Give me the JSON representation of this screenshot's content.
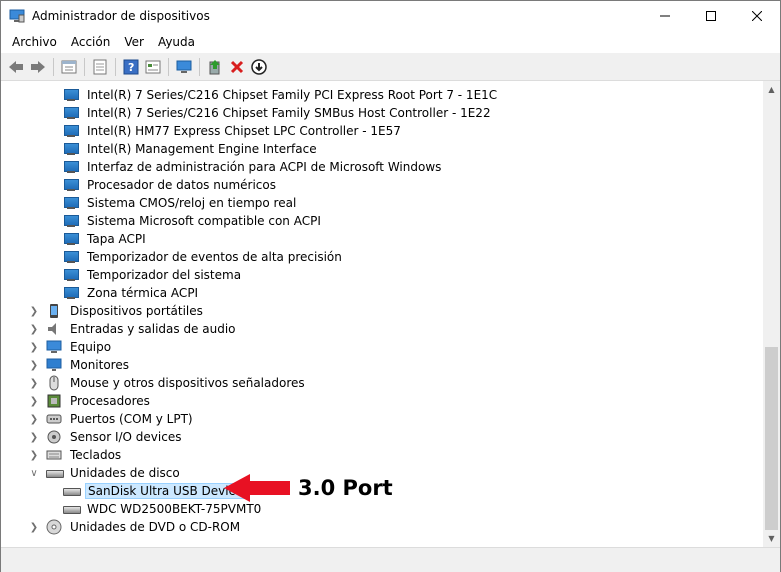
{
  "window": {
    "title": "Administrador de dispositivos"
  },
  "menu": [
    "Archivo",
    "Acción",
    "Ver",
    "Ayuda"
  ],
  "toolbar": [
    "back-icon",
    "forward-icon",
    "properties-icon",
    "show-hidden-icon",
    "help-icon",
    "view-icon",
    "monitor-icon",
    "update-driver-icon",
    "uninstall-icon",
    "disable-icon"
  ],
  "tree": {
    "system_children": [
      "Intel(R) 7 Series/C216 Chipset Family PCI Express Root Port 7 - 1E1C",
      "Intel(R) 7 Series/C216 Chipset Family SMBus Host Controller - 1E22",
      "Intel(R) HM77 Express Chipset LPC Controller - 1E57",
      "Intel(R) Management Engine Interface",
      "Interfaz de administración para ACPI de Microsoft Windows",
      "Procesador de datos numéricos",
      "Sistema CMOS/reloj en tiempo real",
      "Sistema Microsoft compatible con ACPI",
      "Tapa ACPI",
      "Temporizador de eventos de alta precisión",
      "Temporizador del sistema",
      "Zona térmica ACPI"
    ],
    "categories_before": [
      {
        "label": "Dispositivos portátiles",
        "icon": "portable-device-icon"
      },
      {
        "label": "Entradas y salidas de audio",
        "icon": "audio-icon"
      },
      {
        "label": "Equipo",
        "icon": "computer-icon"
      },
      {
        "label": "Monitores",
        "icon": "monitor-icon"
      },
      {
        "label": "Mouse y otros dispositivos señaladores",
        "icon": "mouse-icon"
      },
      {
        "label": "Procesadores",
        "icon": "processor-icon"
      },
      {
        "label": "Puertos (COM y LPT)",
        "icon": "port-icon"
      },
      {
        "label": "Sensor I/O devices",
        "icon": "sensor-icon"
      },
      {
        "label": "Teclados",
        "icon": "keyboard-icon"
      }
    ],
    "disk_category": "Unidades de disco",
    "disks": [
      "SanDisk Ultra USB Device",
      "WDC WD2500BEKT-75PVMT0"
    ],
    "last_category": "Unidades de DVD o CD-ROM"
  },
  "annotation": {
    "text": "3.0 Port",
    "color": "#e81123"
  }
}
